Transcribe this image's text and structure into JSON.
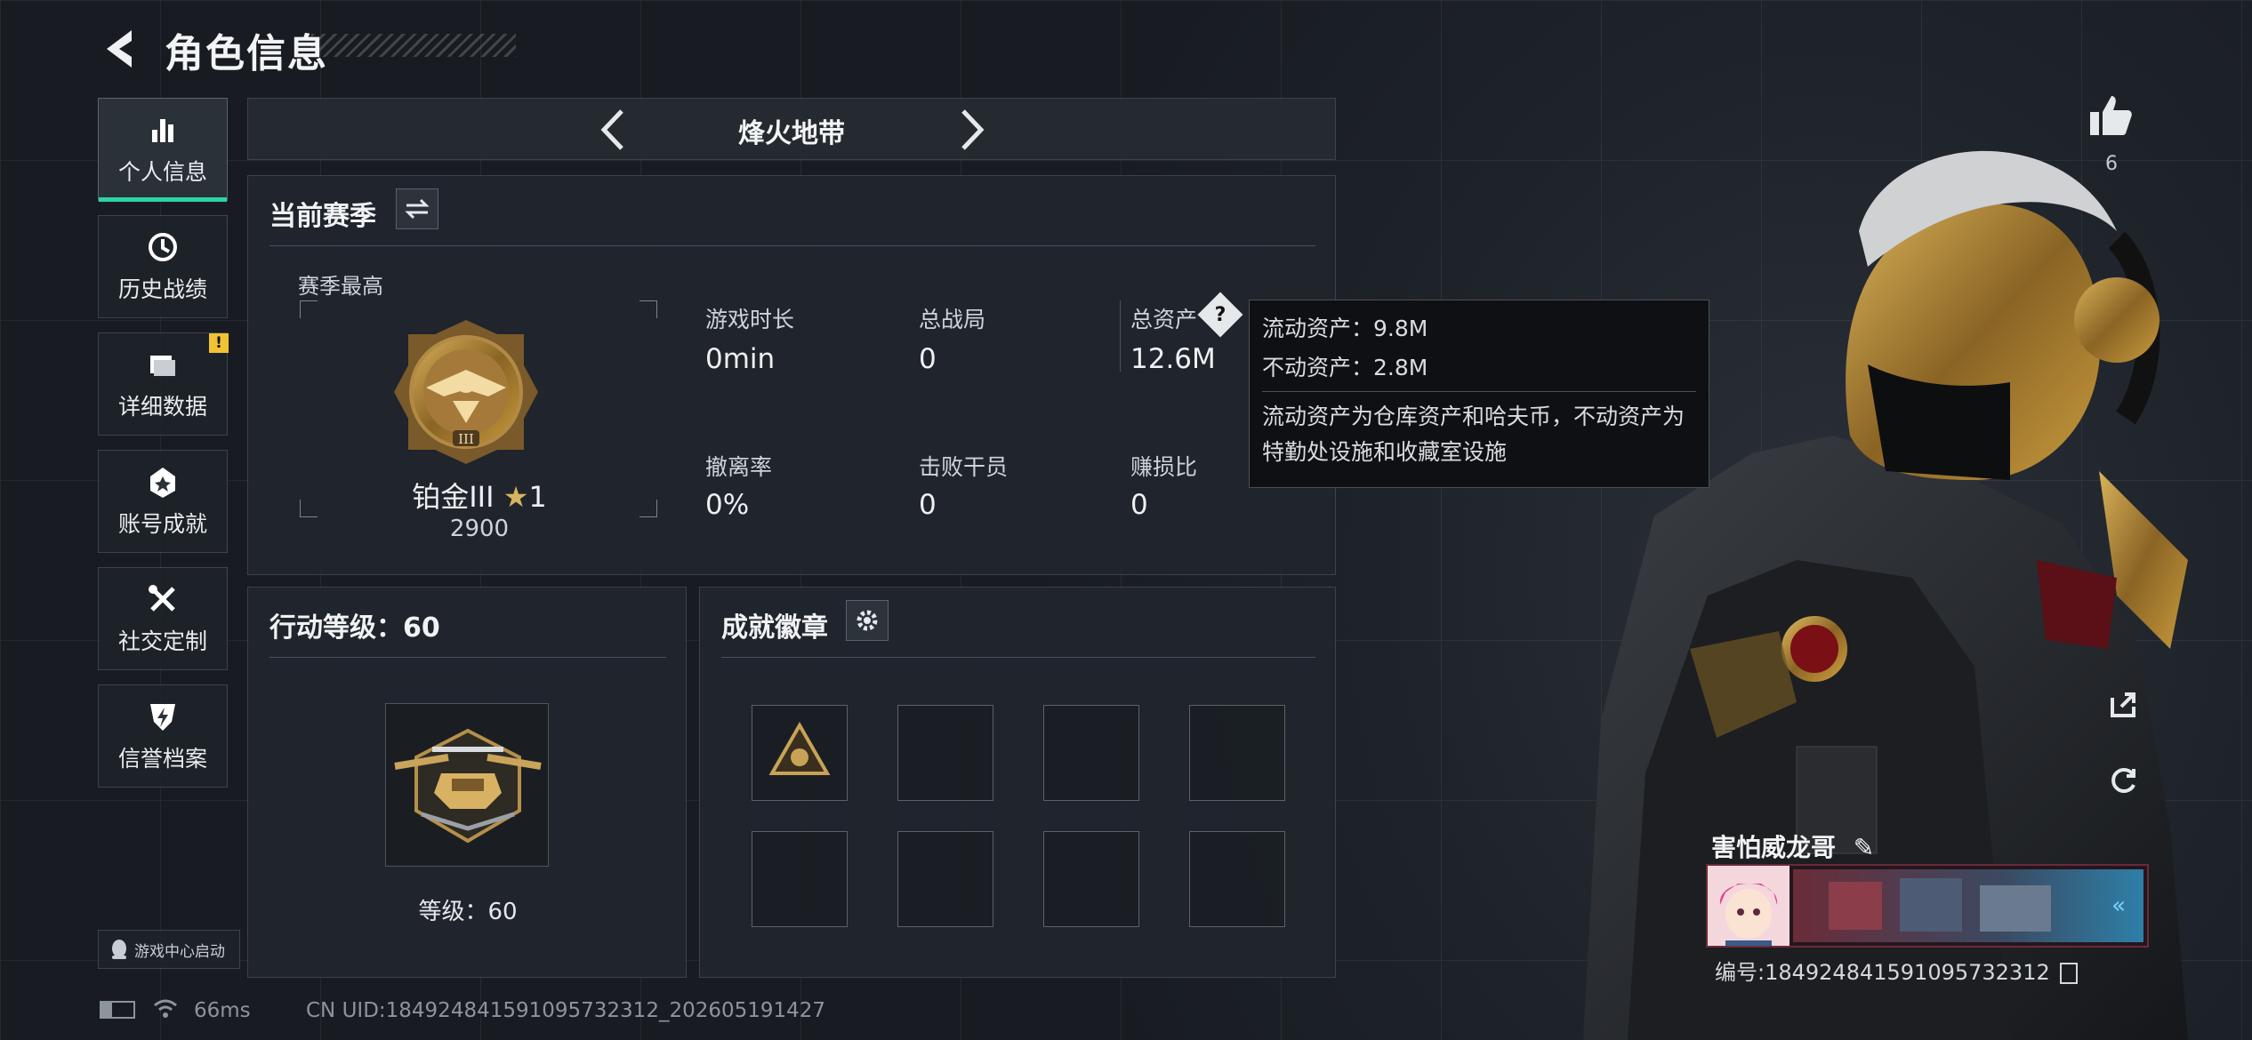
{
  "header": {
    "title": "角色信息"
  },
  "nav": [
    {
      "label": "个人信息",
      "icon": "bar-chart-icon",
      "active": true
    },
    {
      "label": "历史战绩",
      "icon": "clock-history-icon"
    },
    {
      "label": "详细数据",
      "icon": "folder-icon",
      "warning": "!"
    },
    {
      "label": "账号成就",
      "icon": "achievement-badge-icon"
    },
    {
      "label": "社交定制",
      "icon": "wrench-screwdriver-icon"
    },
    {
      "label": "信誉档案",
      "icon": "shield-lightning-icon"
    }
  ],
  "game_center": "游戏中心启动",
  "mode": {
    "name": "烽火地带"
  },
  "season": {
    "title": "当前赛季",
    "best_label": "赛季最高",
    "rank": "铂金III",
    "stars": "1",
    "score": "2900",
    "rank_emblem_roman": "III",
    "stats": [
      {
        "label": "游戏时长",
        "value": "0min"
      },
      {
        "label": "总战局",
        "value": "0"
      },
      {
        "label": "总资产",
        "value": "12.6M"
      },
      {
        "label": "撤离率",
        "value": "0%"
      },
      {
        "label": "击败干员",
        "value": "0"
      },
      {
        "label": "赚损比",
        "value": "0"
      }
    ]
  },
  "tooltip": {
    "liquid": "流动资产：9.8M",
    "fixed": "不动资产：2.8M",
    "description": "流动资产为仓库资产和哈夫币，不动资产为特勤处设施和收藏室设施"
  },
  "action_level": {
    "title": "行动等级：60",
    "level_label": "等级：60"
  },
  "achievements": {
    "title": "成就徽章",
    "slots": 8,
    "filled": 1
  },
  "player": {
    "name": "害怕威龙哥",
    "id_label": "编号:1849248415910957323​12",
    "likes": "6"
  },
  "status": {
    "ping": "66ms",
    "uid": "CN UID:184924841591095732312_202605191427"
  },
  "colors": {
    "accent": "#2bd4a4",
    "warning": "#f1c232",
    "panel": "#21262d"
  }
}
